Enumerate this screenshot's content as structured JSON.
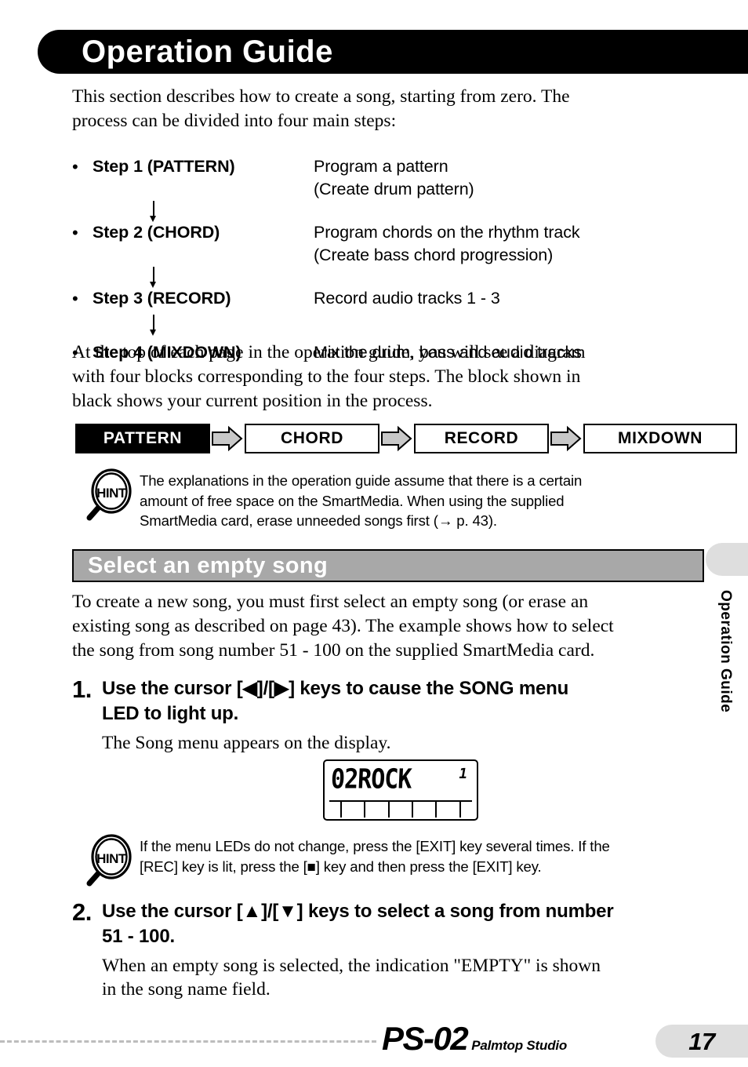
{
  "header": {
    "title": "Operation Guide"
  },
  "intro": {
    "line1": "This section describes how to create a song, starting from zero. The",
    "line2": "process can be divided into four main steps:"
  },
  "steps": {
    "bullet": "•",
    "items": [
      {
        "label": "Step 1 (PATTERN)",
        "desc1": "Program a pattern",
        "desc2": "(Create drum pattern)"
      },
      {
        "label": "Step 2 (CHORD)",
        "desc1": "Program chords on the rhythm track",
        "desc2": "(Create bass chord progression)"
      },
      {
        "label": "Step 3 (RECORD)",
        "desc1": "Record audio tracks 1 - 3",
        "desc2": ""
      },
      {
        "label": "Step 4 (MIXDOWN)",
        "desc1": "Mix the drum, bass and audio tracks",
        "desc2": ""
      }
    ]
  },
  "diagram_intro": {
    "line1": "At the top of each page in the operation guide, you will see a diagram",
    "line2": "with four blocks corresponding to the four steps. The block shown in",
    "line3": "black shows your current position in the process."
  },
  "flow": {
    "blocks": [
      {
        "label": "PATTERN",
        "active": true
      },
      {
        "label": "CHORD",
        "active": false
      },
      {
        "label": "RECORD",
        "active": false
      },
      {
        "label": "MIXDOWN",
        "active": false
      }
    ]
  },
  "hint1": {
    "icon_label": "HINT",
    "line1": "The explanations in the operation guide assume that there is a certain",
    "line2": "amount of free space on the SmartMedia. When using the supplied",
    "line3": "SmartMedia card, erase unneeded songs first (→ p. 43)."
  },
  "section": {
    "title": "Select an empty song"
  },
  "section_intro": {
    "line1": "To create a new song, you must first select an empty song (or erase an",
    "line2": "existing song as described on page 43). The example shows how to select",
    "line3": "the song from song number 51 - 100 on the supplied SmartMedia card."
  },
  "step1": {
    "number": "1.",
    "title_line1": "Use the cursor [◀]/[▶] keys to cause the SONG menu",
    "title_line2": "LED to light up.",
    "body_line1": "The Song menu appears on the display."
  },
  "lcd": {
    "song_name": "02ROCK",
    "right_indicator": "1"
  },
  "hint2": {
    "icon_label": "HINT",
    "line1": "If the menu LEDs do not change, press the [EXIT] key several times. If the",
    "line2": "[REC] key is lit, press the [■] key and then press the [EXIT] key."
  },
  "step2": {
    "number": "2.",
    "title_line1": "Use the cursor [▲]/[▼] keys to select a song from number",
    "title_line2": "51 - 100.",
    "body_line1": "When an empty song is selected, the indication \"EMPTY\" is shown",
    "body_line2": "in the song name field."
  },
  "side_tab": {
    "label": "Operation Guide"
  },
  "footer": {
    "logo": "PS-02",
    "logo_sub": "Palmtop Studio",
    "page_number": "17"
  },
  "colors": {
    "banner_bg": "#000000",
    "section_bg": "#a8a8a8",
    "arrow_fill": "#c8c8c8",
    "tab_gray": "#dedede"
  }
}
